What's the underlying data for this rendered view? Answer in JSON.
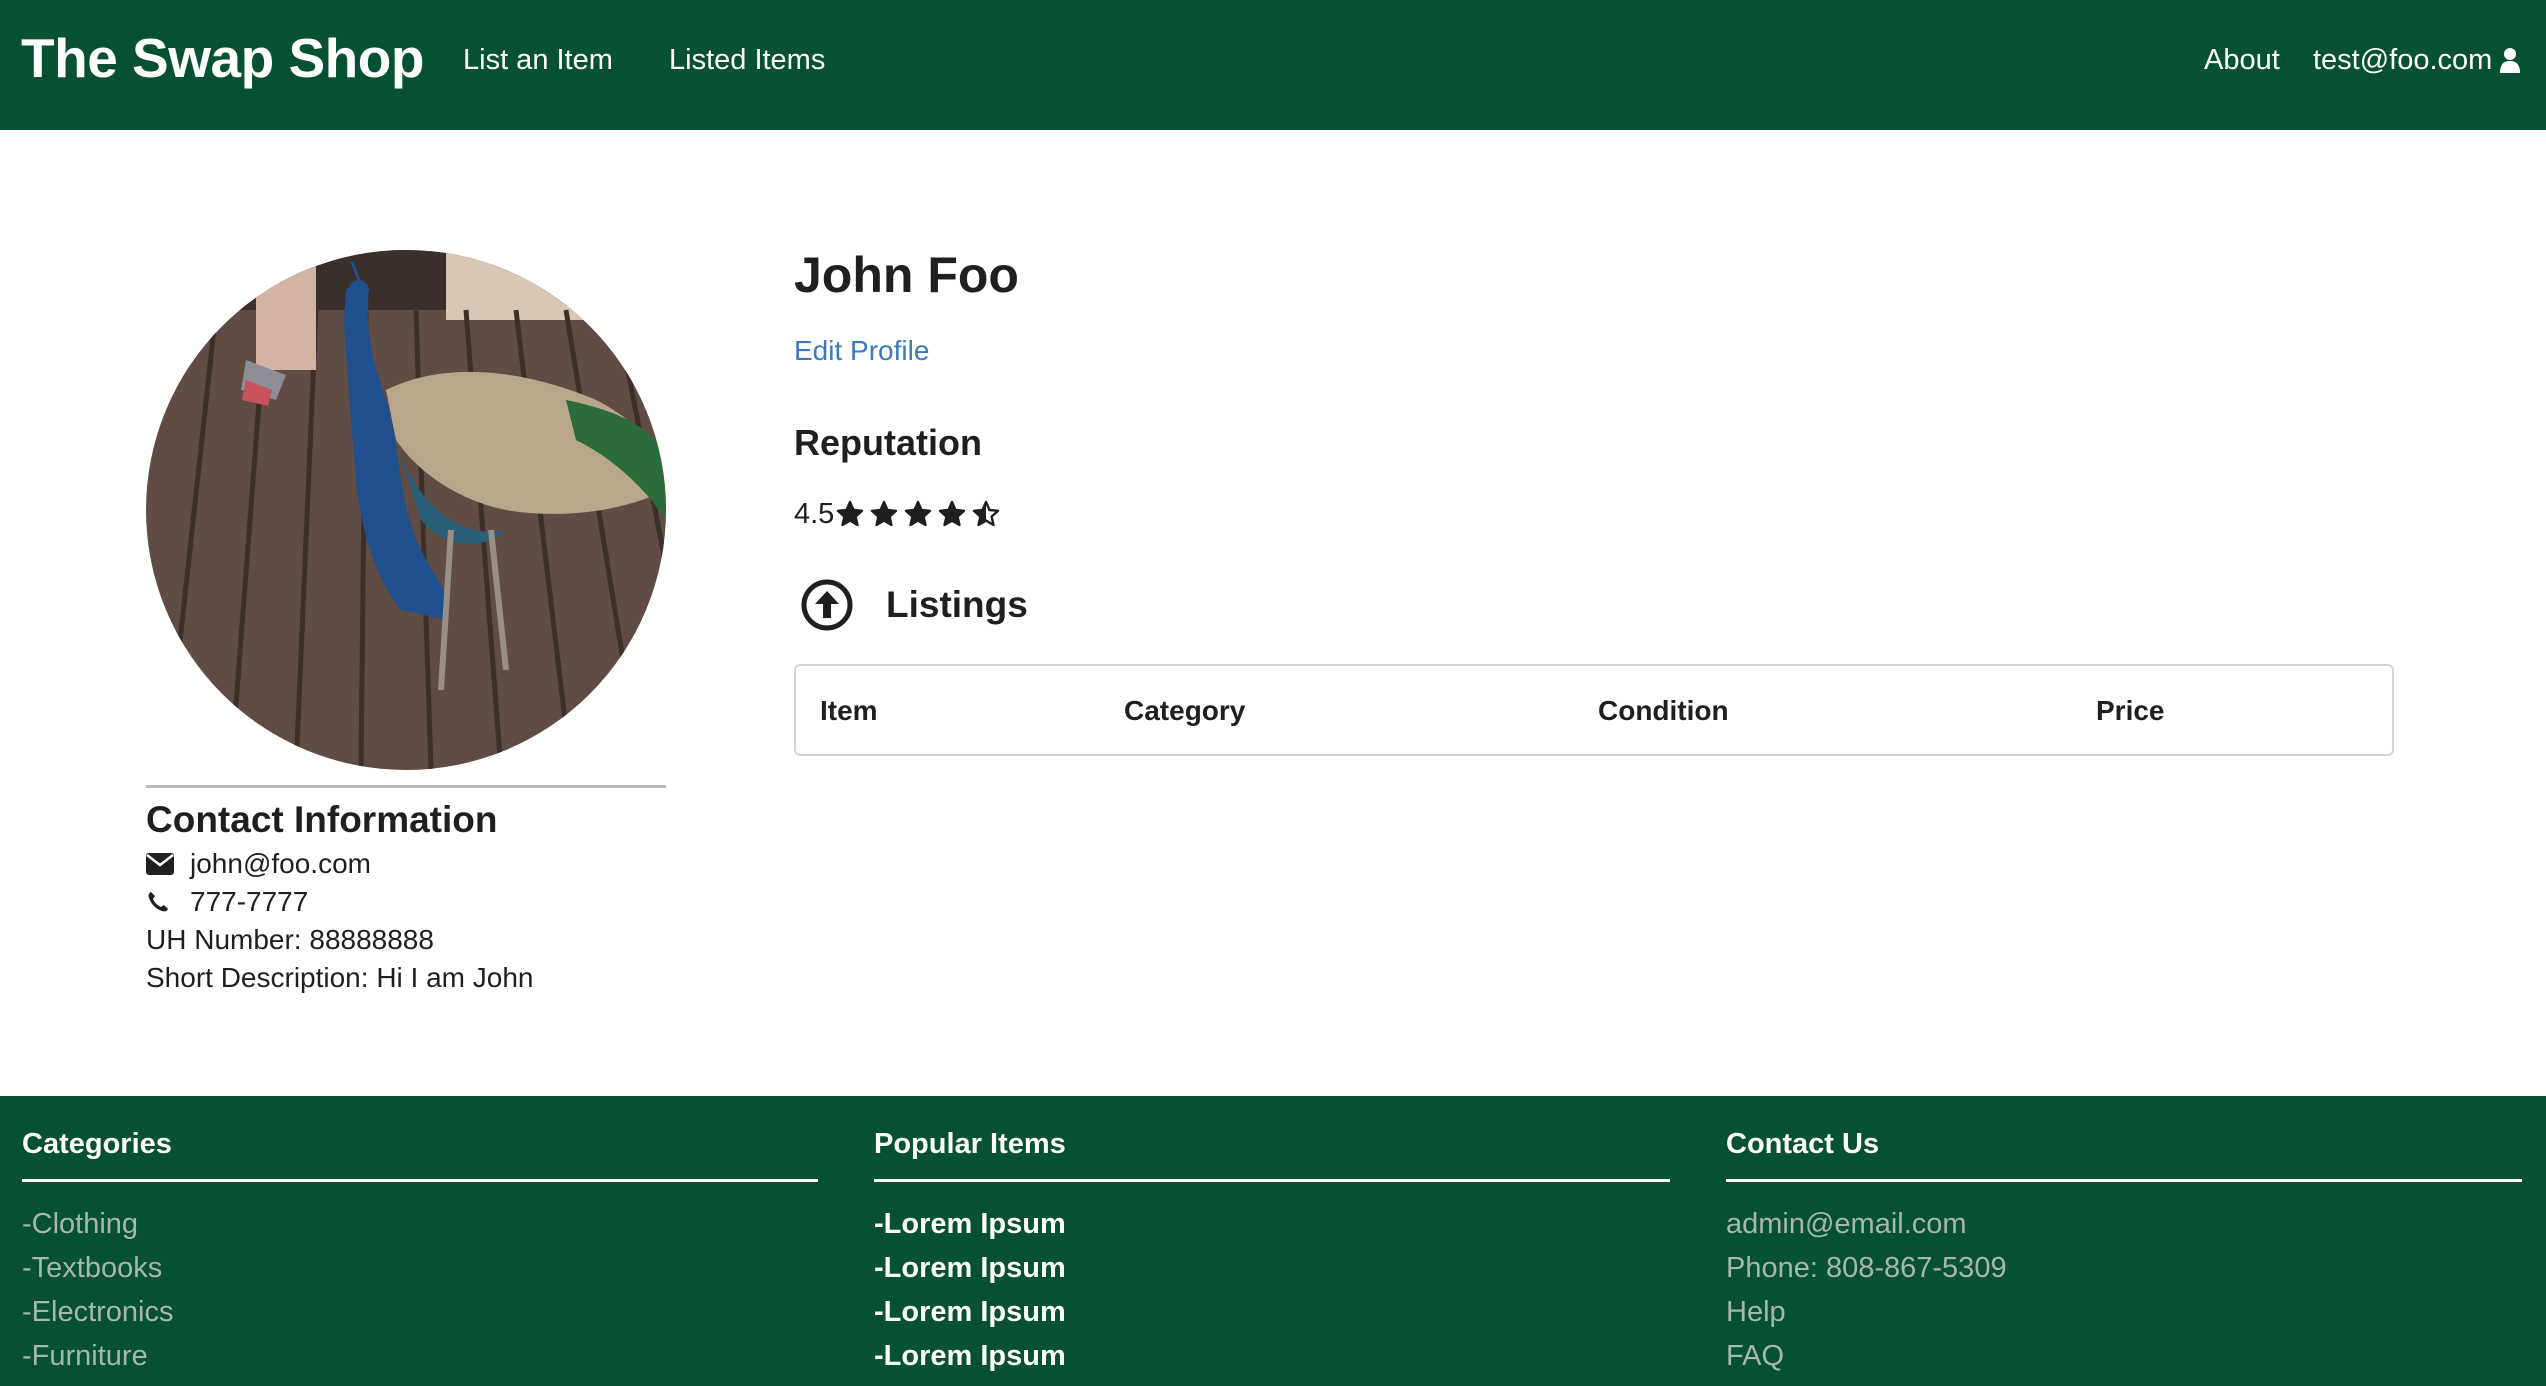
{
  "navbar": {
    "brand": "The Swap Shop",
    "list_item": "List an Item",
    "listed_items": "Listed Items",
    "about": "About",
    "user_email": "test@foo.com",
    "user_icon": "user-icon"
  },
  "profile": {
    "avatar": "peacock-photo",
    "contact_title": "Contact Information",
    "email_icon": "envelope-icon",
    "email": "john@foo.com",
    "phone_icon": "phone-icon",
    "phone": "777-7777",
    "uh_number": "UH Number: 88888888",
    "description": "Short Description: Hi I am John"
  },
  "main": {
    "name": "John Foo",
    "edit_profile": "Edit Profile",
    "reputation_title": "Reputation",
    "rating": "4.5",
    "rating_value": 4.5,
    "rating_max": 5,
    "listings_icon": "arrow-circle-up-icon",
    "listings_title": "Listings",
    "table_headers": [
      "Item",
      "Category",
      "Condition",
      "Price"
    ]
  },
  "footer": {
    "categories": {
      "title": "Categories",
      "items": [
        "-Clothing",
        "-Textbooks",
        "-Electronics",
        "-Furniture"
      ]
    },
    "popular": {
      "title": "Popular Items",
      "items": [
        "-Lorem Ipsum",
        "-Lorem Ipsum",
        "-Lorem Ipsum",
        "-Lorem Ipsum"
      ]
    },
    "contact": {
      "title": "Contact Us",
      "items": [
        "admin@email.com",
        "Phone: 808-867-5309",
        "Help",
        "FAQ"
      ]
    }
  },
  "colors": {
    "brand_green": "#065131",
    "link_blue": "#3c79bd",
    "footer_muted": "#a6b7ae"
  }
}
